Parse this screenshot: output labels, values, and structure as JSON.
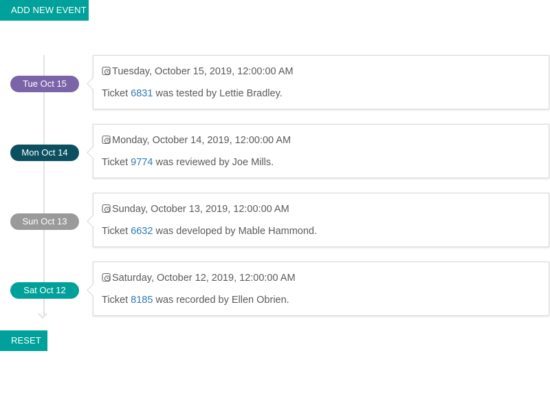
{
  "toolbar": {
    "add_label": "ADD NEW EVENT",
    "reset_label": "RESET"
  },
  "colors": {
    "accent": "#00a19a",
    "link": "#2e7bb4",
    "line": "#e2e2e2"
  },
  "events": [
    {
      "pill": "Tue Oct 15",
      "pill_color": "#7b64a8",
      "date": "Tuesday, October 15, 2019, 12:00:00 AM",
      "prefix": "Ticket ",
      "ticket": "6831",
      "suffix": " was tested by Lettie Bradley."
    },
    {
      "pill": "Mon Oct 14",
      "pill_color": "#0c5060",
      "date": "Monday, October 14, 2019, 12:00:00 AM",
      "prefix": "Ticket ",
      "ticket": "9774",
      "suffix": " was reviewed by Joe Mills."
    },
    {
      "pill": "Sun Oct 13",
      "pill_color": "#9a9a9a",
      "date": "Sunday, October 13, 2019, 12:00:00 AM",
      "prefix": "Ticket ",
      "ticket": "6632",
      "suffix": " was developed by Mable Hammond."
    },
    {
      "pill": "Sat Oct 12",
      "pill_color": "#00a19a",
      "date": "Saturday, October 12, 2019, 12:00:00 AM",
      "prefix": "Ticket ",
      "ticket": "8185",
      "suffix": " was recorded by Ellen Obrien."
    }
  ]
}
